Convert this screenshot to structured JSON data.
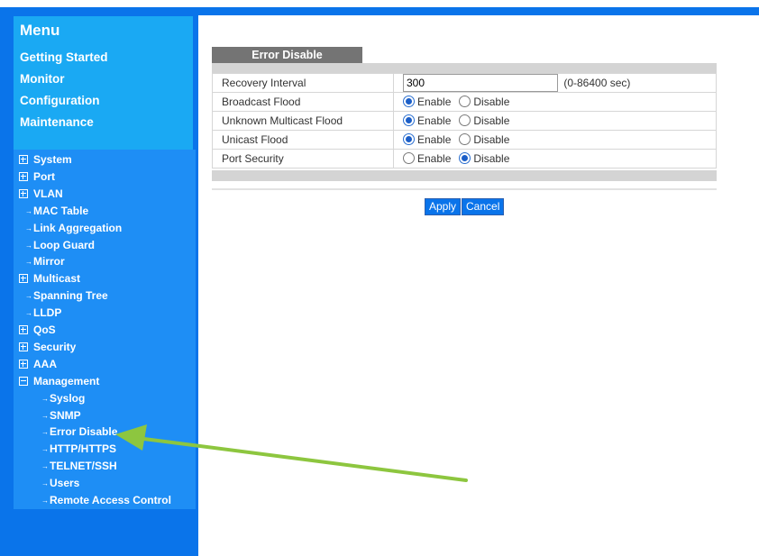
{
  "sidebar": {
    "menu_title": "Menu",
    "links": [
      "Getting Started",
      "Monitor",
      "Configuration",
      "Maintenance"
    ],
    "tree": [
      {
        "label": "System",
        "kind": "plus"
      },
      {
        "label": "Port",
        "kind": "plus"
      },
      {
        "label": "VLAN",
        "kind": "plus"
      },
      {
        "label": "MAC Table",
        "kind": "bullet"
      },
      {
        "label": "Link Aggregation",
        "kind": "bullet"
      },
      {
        "label": "Loop Guard",
        "kind": "bullet"
      },
      {
        "label": "Mirror",
        "kind": "bullet"
      },
      {
        "label": "Multicast",
        "kind": "plus"
      },
      {
        "label": "Spanning Tree",
        "kind": "bullet"
      },
      {
        "label": "LLDP",
        "kind": "bullet"
      },
      {
        "label": "QoS",
        "kind": "plus"
      },
      {
        "label": "Security",
        "kind": "plus"
      },
      {
        "label": "AAA",
        "kind": "plus"
      },
      {
        "label": "Management",
        "kind": "minus"
      },
      {
        "label": "Syslog",
        "kind": "sub"
      },
      {
        "label": "SNMP",
        "kind": "sub"
      },
      {
        "label": "Error Disable",
        "kind": "sub"
      },
      {
        "label": "HTTP/HTTPS",
        "kind": "sub"
      },
      {
        "label": "TELNET/SSH",
        "kind": "sub"
      },
      {
        "label": "Users",
        "kind": "sub"
      },
      {
        "label": "Remote Access Control",
        "kind": "sub"
      }
    ]
  },
  "main": {
    "header": "Error Disable",
    "recovery": {
      "label": "Recovery Interval",
      "value": "300",
      "range": "(0-86400 sec)"
    },
    "enable_label": "Enable",
    "disable_label": "Disable",
    "rows": [
      {
        "label": "Broadcast Flood",
        "selected": "enable"
      },
      {
        "label": "Unknown Multicast Flood",
        "selected": "enable"
      },
      {
        "label": "Unicast Flood",
        "selected": "enable"
      },
      {
        "label": "Port Security",
        "selected": "disable"
      }
    ],
    "apply_label": "Apply",
    "cancel_label": "Cancel"
  },
  "colors": {
    "sidebar": "#0a74ea",
    "menu_panel": "#1aa9f3",
    "tree_panel": "#1e8ef5",
    "header_tab": "#747474",
    "annotation_arrow": "#8dc63f"
  },
  "icons": {
    "plus": "expand-plus-icon",
    "minus": "collapse-minus-icon",
    "bullet": "arrow-bullet-icon"
  }
}
